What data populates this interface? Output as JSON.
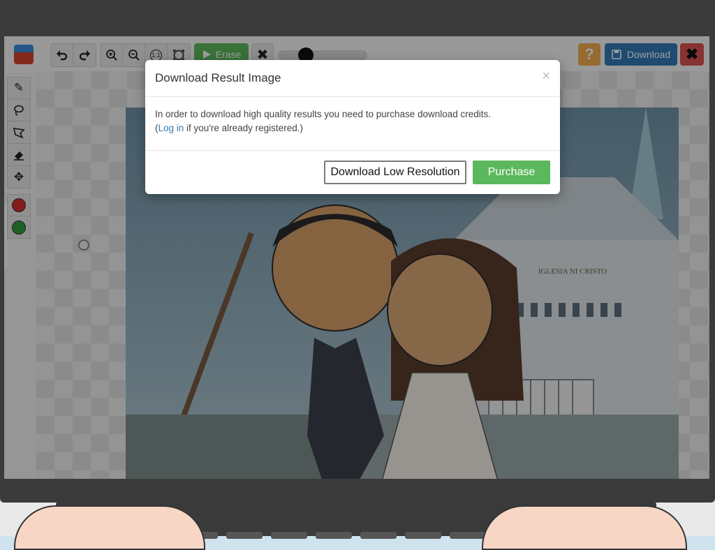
{
  "toolbar": {
    "undo_icon": "undo-icon",
    "redo_icon": "redo-icon",
    "zoom_in_icon": "zoom-in-icon",
    "zoom_out_icon": "zoom-out-icon",
    "actual_size_label": "1:1",
    "fit_icon": "fit-screen-icon",
    "erase_label": "Erase",
    "download_label": "Download",
    "help_label": "?"
  },
  "tools": [
    "pencil-icon",
    "lasso-icon",
    "polygon-lasso-icon",
    "eraser-icon",
    "move-icon"
  ],
  "colors": {
    "red": "#d32f2f",
    "green": "#2e9e3a",
    "accent_green": "#5cb85c",
    "accent_blue": "#337ab7"
  },
  "modal": {
    "title": "Download Result Image",
    "close": "×",
    "body_line1": "In order to download high quality results you need to purchase download credits.",
    "body_open": "(",
    "login_link": "Log in",
    "body_rest": " if you're already registered.)",
    "low_res_button": "Download Low Resolution",
    "purchase_button": "Purchase"
  },
  "artwork": {
    "building_sign": "IGLESIA NI CRISTO"
  }
}
